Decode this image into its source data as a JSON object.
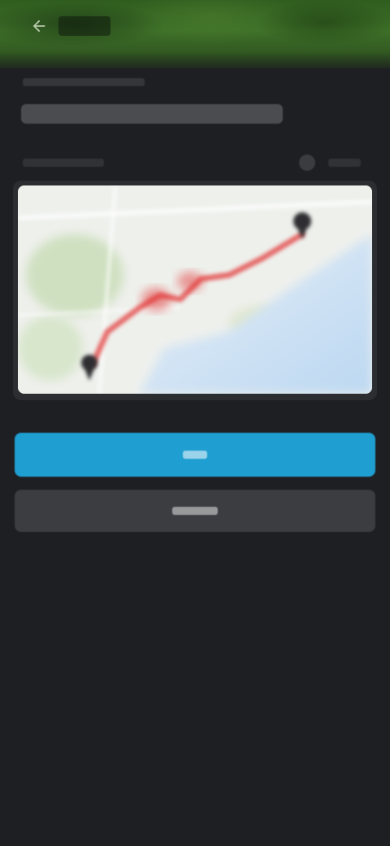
{
  "header": {
    "back_icon": "arrow-left-icon",
    "background": "#3d6f28"
  },
  "page": {
    "title": ""
  },
  "map": {
    "land_color": "#eef0ec",
    "water_color": "#cfe3f5",
    "route_color": "#e23b3b",
    "start_marker_icon": "map-pin-icon",
    "end_marker_icon": "map-pin-icon"
  },
  "actions": {
    "primary_label": "",
    "primary_color": "#1f9ed1",
    "secondary_label": "",
    "secondary_color": "#3b3d41"
  }
}
